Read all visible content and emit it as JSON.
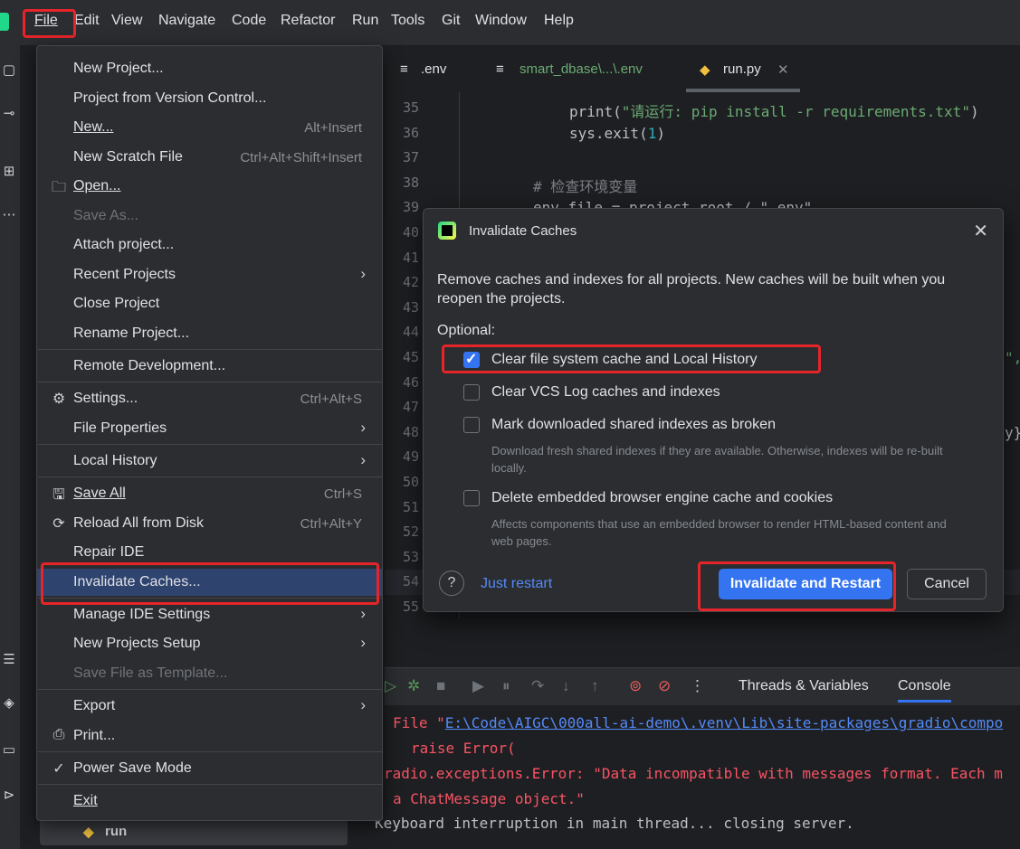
{
  "menubar": {
    "items": [
      "File",
      "Edit",
      "View",
      "Navigate",
      "Code",
      "Refactor",
      "Run",
      "Tools",
      "Git",
      "Window",
      "Help"
    ]
  },
  "tabs": [
    {
      "label": ".env"
    },
    {
      "label": "smart_dbase\\...\\.env"
    },
    {
      "label": "run.py"
    }
  ],
  "editor": {
    "line_numbers": [
      "35",
      "36",
      "37",
      "38",
      "39",
      "40",
      "41",
      "42",
      "43",
      "44",
      "45",
      "46",
      "47",
      "48",
      "49",
      "50",
      "51",
      "52",
      "53",
      "54",
      "55"
    ],
    "line35_fn": "print(",
    "line35_str": "\"请运行: pip install -r requirements.txt\"",
    "line35_end": ")",
    "line36_fn": "sys.exit(",
    "line36_num": "1",
    "line36_end": ")",
    "line38_comment": "# 检查环境变量",
    "line39_partial": "env_file = project_root / \".env\"",
    "line45_tail": "\",",
    "line48_tail": "y}"
  },
  "bottom_panel": {
    "tab_threads": "Threads & Variables",
    "tab_console": "Console",
    "console": {
      "line1_prefix": "File \"",
      "line1_link": "E:\\Code\\AIGC\\000all-ai-demo\\.venv\\Lib\\site-packages\\gradio\\compo",
      "line2": "raise Error(",
      "line3": "radio.exceptions.Error: \"Data incompatible with messages format. Each m",
      "line4": "a ChatMessage object.\"",
      "line5": "Keyboard interruption in main thread... closing server."
    }
  },
  "run_item": {
    "label": "run"
  },
  "file_menu": {
    "new_project": "New Project...",
    "project_from_vcs": "Project from Version Control...",
    "new": "New...",
    "new_shortcut": "Alt+Insert",
    "new_scratch": "New Scratch File",
    "new_scratch_shortcut": "Ctrl+Alt+Shift+Insert",
    "open": "Open...",
    "save_as": "Save As...",
    "attach_project": "Attach project...",
    "recent_projects": "Recent Projects",
    "close_project": "Close Project",
    "rename_project": "Rename Project...",
    "remote_dev": "Remote Development...",
    "settings": "Settings...",
    "settings_shortcut": "Ctrl+Alt+S",
    "file_properties": "File Properties",
    "local_history": "Local History",
    "save_all": "Save All",
    "save_all_shortcut": "Ctrl+S",
    "reload_all": "Reload All from Disk",
    "reload_all_shortcut": "Ctrl+Alt+Y",
    "repair_ide": "Repair IDE",
    "invalidate_caches": "Invalidate Caches...",
    "manage_ide_settings": "Manage IDE Settings",
    "new_projects_setup": "New Projects Setup",
    "save_as_template": "Save File as Template...",
    "export": "Export",
    "print": "Print...",
    "power_save": "Power Save Mode",
    "exit": "Exit"
  },
  "dialog": {
    "title": "Invalidate Caches",
    "description": "Remove caches and indexes for all projects. New caches will be built when you reopen the projects.",
    "optional": "Optional:",
    "opt1": "Clear file system cache and Local History",
    "opt2": "Clear VCS Log caches and indexes",
    "opt3": "Mark downloaded shared indexes as broken",
    "opt3_hint": "Download fresh shared indexes if they are available. Otherwise, indexes will be re-built locally.",
    "opt4": "Delete embedded browser engine cache and cookies",
    "opt4_hint": "Affects components that use an embedded browser to render HTML-based content and web pages.",
    "help": "?",
    "just_restart": "Just restart",
    "invalidate_restart": "Invalidate and Restart",
    "cancel": "Cancel",
    "close_glyph": "✕"
  },
  "colors": {
    "accent": "#3574f0",
    "highlight_red": "#e5252a",
    "menu_bg": "#2b2d30",
    "editor_bg": "#1e1f22"
  }
}
